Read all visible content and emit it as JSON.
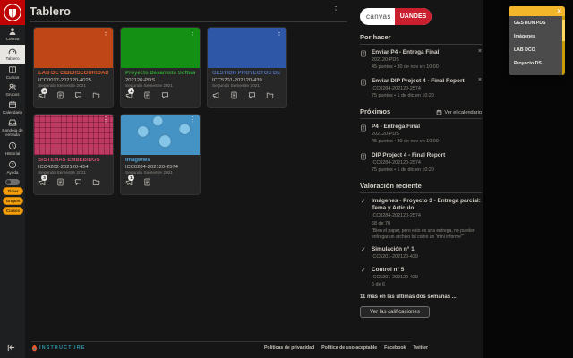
{
  "app": {
    "title": "Tablero"
  },
  "icons": {
    "kebab": "⋮",
    "close": "×",
    "check": "✓"
  },
  "colors": {
    "brand_red": "#c00404",
    "canvas_red": "#ca1f2f",
    "popup_yellow": "#f3b52a",
    "pill_orange": "#f59e0b",
    "card_colors": [
      "#bf4616",
      "#149014",
      "#2f57a8",
      "#bf3a63",
      "#4493c4"
    ],
    "instructure_teal": "#2d8fa5"
  },
  "nav": {
    "items": [
      {
        "label": "Cuenta"
      },
      {
        "label": "Tablero"
      },
      {
        "label": "Cursos"
      },
      {
        "label": "Grupos"
      },
      {
        "label": "Calendario"
      },
      {
        "label": "Bandeja de entrada"
      },
      {
        "label": "Historial"
      },
      {
        "label": "Ayuda"
      }
    ],
    "pills": [
      "Timer",
      "Grupos",
      "Cursos"
    ]
  },
  "cards": [
    {
      "title": "LAB DE CIBERSEGURIDAD OFEN",
      "code": "ICC0017-202120-4025",
      "term": "Segundo Semestre 2021",
      "badge": "3"
    },
    {
      "title": "Proyecto Desarrollo Software",
      "code": "202120-PDS",
      "term": "Segundo Semestre 2021",
      "badge": "1"
    },
    {
      "title": "GESTION PROYECTOS DE SOFT",
      "code": "ICC5201-202120-439",
      "term": "Segundo Semestre 2021"
    },
    {
      "title": "SISTEMAS EMBEBIDOS",
      "code": "ICC4202-202120-454",
      "term": "Segundo Semestre 2021",
      "badge": "3"
    },
    {
      "title": "Imágenes",
      "code": "ICC0284-202120-2574",
      "term": "Segundo Semestre 2021",
      "badge": "1"
    }
  ],
  "right": {
    "logo": {
      "left": "canvas",
      "right": "UANDES"
    },
    "todo": {
      "heading": "Por hacer",
      "items": [
        {
          "title": "Enviar P4 - Entrega Final",
          "course": "202120-PDS",
          "meta": "45 puntos • 30 de nov en 10:00"
        },
        {
          "title": "Enviar DIP Project 4 - Final Report",
          "course": "ICC0284-202120-2574",
          "meta": "75 puntos • 1 de dic en 10:20"
        }
      ]
    },
    "upcoming": {
      "heading": "Próximos",
      "calendar_link": "Ver el calendario",
      "items": [
        {
          "title": "P4 - Entrega Final",
          "course": "202120-PDS",
          "meta": "45 puntos • 30 de nov en 10:00"
        },
        {
          "title": "DIP Project 4 - Final Report",
          "course": "ICC0284-202120-2574",
          "meta": "75 puntos • 1 de dic en 10:20"
        }
      ]
    },
    "feedback": {
      "heading": "Valoración reciente",
      "items": [
        {
          "title": "Imágenes - Proyecto 3 - Entrega parcial: Tema y Artículo",
          "course": "ICC0284-202120-2574",
          "score": "68 de 70",
          "comment": "\"Bien el paper, pero esto es una entrega, no pueden entregar un archivo txt como un 'mini informe'\""
        },
        {
          "title": "Simulación n° 1",
          "course": "ICC5201-202120-439"
        },
        {
          "title": "Control n° 5",
          "course": "ICC5201-202120-439",
          "score": "6 de 6"
        }
      ],
      "more": "11 más en las últimas dos semanas ...",
      "button": "Ver las calificaciones"
    }
  },
  "popup": {
    "items": [
      "GESTION PDS",
      "Imágenes",
      "LAB DCO",
      "Proyecto DS"
    ]
  },
  "footer": {
    "links": [
      "Políticas de privacidad",
      "Política de uso aceptable",
      "Facebook",
      "Twitter"
    ],
    "brand": "INSTRUCTURE"
  }
}
